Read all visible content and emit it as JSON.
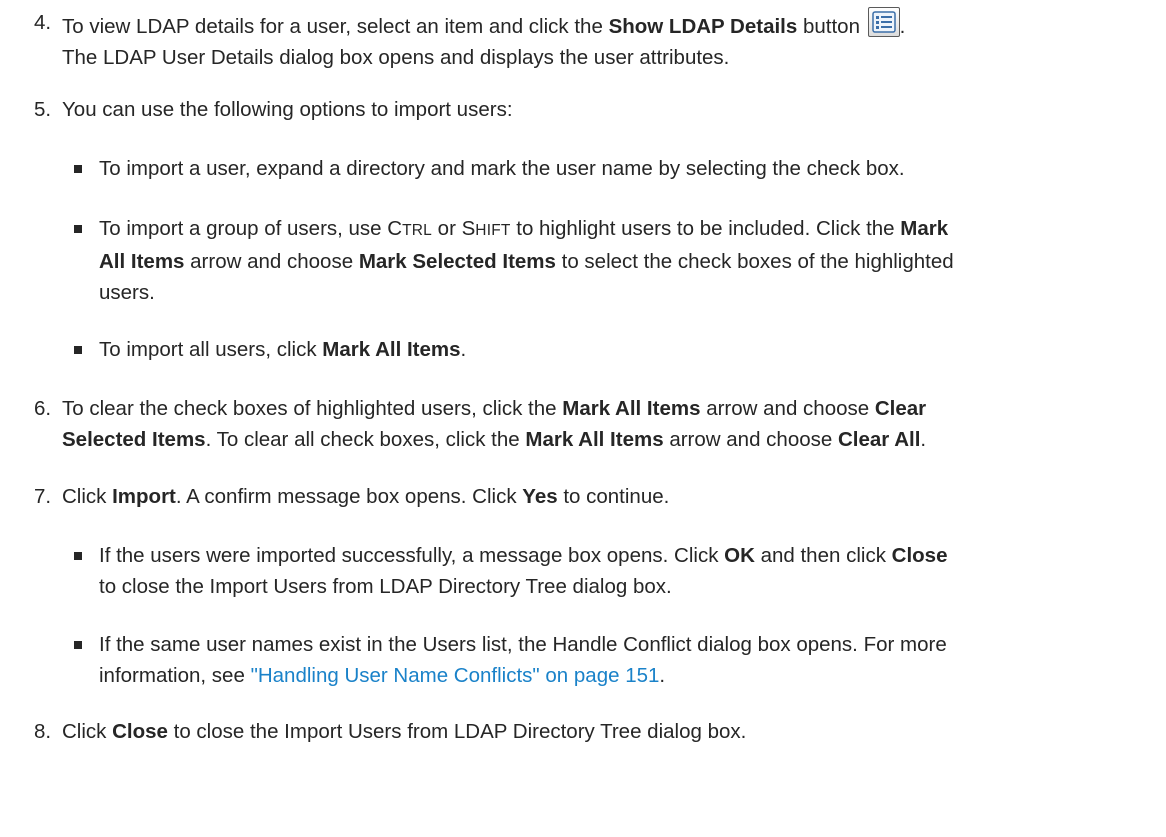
{
  "steps": [
    {
      "num": "4.",
      "line1_pre": "To view LDAP details for a user, select an item and click the ",
      "line1_bold": "Show LDAP Details",
      "line1_mid": " button ",
      "line1_post": ".",
      "line2": "The LDAP User Details dialog box opens and displays the user attributes."
    },
    {
      "num": "5.",
      "text": "You can use the following options to import users:",
      "bullets": [
        {
          "text": "To import a user, expand a directory and mark the user name by selecting the check box."
        },
        {
          "t1": "To import a group of users, use ",
          "ctrl_c": "C",
          "ctrl_rest": "TRL",
          "t2": " or ",
          "shift_s": "S",
          "shift_rest": "HIFT",
          "t3": " to highlight users to be included. Click the ",
          "b1": "Mark",
          "b1b": "All Items",
          "t4": " arrow and choose ",
          "b2": "Mark Selected Items",
          "t5": " to select the check boxes of the highlighted",
          "t6": "users."
        },
        {
          "t1": "To import all users, click ",
          "b1": "Mark All Items",
          "t2": "."
        }
      ]
    },
    {
      "num": "6.",
      "t1": "To clear the check boxes of highlighted users, click the ",
      "b1": "Mark All Items",
      "t2": " arrow and choose ",
      "b2": "Clear",
      "b2b": "Selected Items",
      "t3": ". To clear all check boxes, click the ",
      "b3": "Mark All Items",
      "t4": " arrow and choose ",
      "b4": "Clear All",
      "t5": "."
    },
    {
      "num": "7.",
      "t1": "Click ",
      "b1": "Import",
      "t2": ". A confirm message box opens. Click ",
      "b2": "Yes",
      "t3": " to continue.",
      "bullets": [
        {
          "t1": "If the users were imported successfully, a message box opens. Click ",
          "b1": "OK",
          "t2": " and then click ",
          "b2": "Close",
          "t3": "to close the Import Users from LDAP Directory Tree dialog box."
        },
        {
          "t1": "If the same user names exist in the Users list, the Handle Conflict dialog box opens. For more",
          "t2": "information, see ",
          "link": "\"Handling User Name Conflicts\" on page 151",
          "t3": "."
        }
      ]
    },
    {
      "num": "8.",
      "t1": "Click ",
      "b1": "Close",
      "t2": " to close the Import Users from LDAP Directory Tree dialog box."
    }
  ],
  "icons": {
    "show_ldap_details": "details-list-icon"
  }
}
